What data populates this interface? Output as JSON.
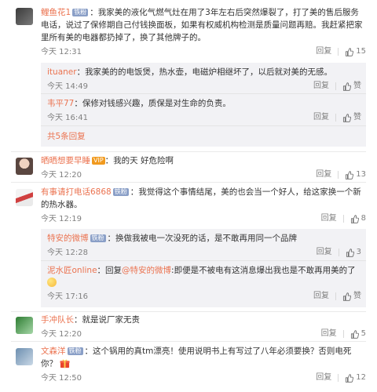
{
  "labels": {
    "reply": "回复",
    "like": "赞"
  },
  "comments": [
    {
      "name": "鲤鱼花1",
      "badge": "铁粉",
      "text": "我家美的液化气燃气灶在用了3年左右后突然爆裂了，打了美的售后服务电话，说过了保修期自己付钱换面板，如果有权威机构检测是质量问题再赔。我赶紧把家里所有美的电器都扔掉了，换了其他牌子的。",
      "time": "今天 12:31",
      "likes": "15",
      "replies": [
        {
          "name": "ituaner",
          "text": "我家美的的电饭煲，热水壶，电磁炉相继坏了，以后就对美的无感。",
          "time": "今天 14:49",
          "likes": ""
        },
        {
          "name": "韦平77",
          "text": "保修对钱感兴趣，质保是对生命的负责。",
          "time": "今天 16:41",
          "likes": ""
        }
      ],
      "more": "共5条回复"
    },
    {
      "name": "晒晒想要早睡",
      "vip": "VIP",
      "text": "我的天 好危险啊",
      "time": "今天 12:20",
      "likes": "13"
    },
    {
      "name": "有事请打电话6868",
      "badge": "铁粉",
      "text": "我觉得这个事情结尾，美的也会当一个好人，给这家换一个新的热水器。",
      "time": "今天 12:19",
      "likes": "8",
      "replies": [
        {
          "name": "特安的微博",
          "badge": "铁粉",
          "text": "换做我被电一次没死的话，是不敢再用同一个品牌",
          "time": "今天 12:28",
          "likes": "3"
        },
        {
          "name": "泥水匠online",
          "prefix": "回复",
          "mention": "@特安的微博",
          "text": ":即便是不被电有这消息爆出我也是不敢再用美的了",
          "time": "今天 17:16",
          "likes": ""
        }
      ]
    },
    {
      "name": "手冲队长",
      "text": "就是说厂家无责",
      "time": "今天 12:20",
      "likes": "5"
    },
    {
      "name": "文森洋",
      "badge": "铁粉",
      "text": "这个锅用的真tm漂亮！使用说明书上有写过了八年必须要换？否则电死你？",
      "time": "今天 12:50",
      "likes": "12"
    }
  ]
}
